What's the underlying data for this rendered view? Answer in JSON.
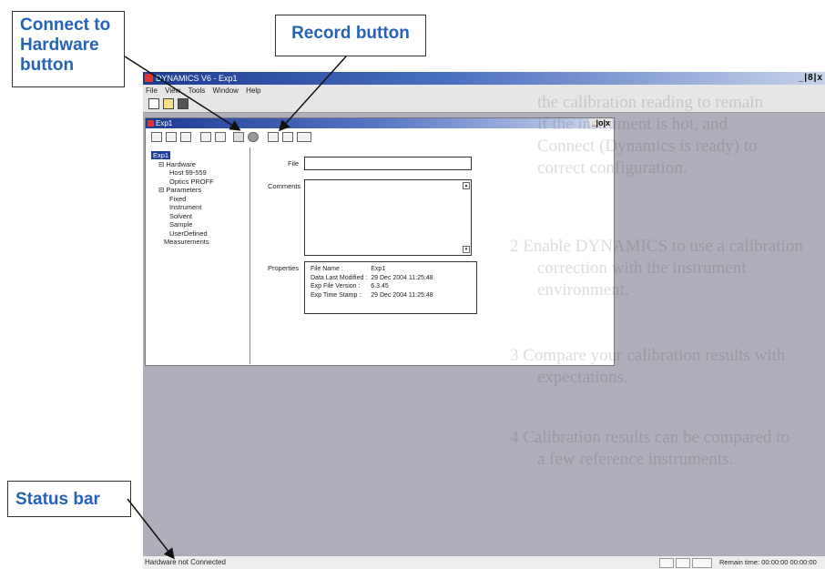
{
  "callouts": {
    "connect": "Connect to Hardware button",
    "record": "Record button",
    "status": "Status bar"
  },
  "app": {
    "title": "DYNAMICS V6 - Exp1",
    "window_controls": "_|8|x",
    "menu": [
      "File",
      "View",
      "Tools",
      "Window",
      "Help"
    ]
  },
  "child": {
    "title": "Exp1",
    "window_controls": "_|o|x",
    "tree": {
      "root": "Exp1",
      "hardware": "Hardware",
      "hw_items": [
        "Host 99-559",
        "Optics PROFF"
      ],
      "parameters": "Parameters",
      "param_items": [
        "Fixed",
        "Instrument",
        "Solvent",
        "Sample",
        "UserDefined"
      ],
      "measurements": "Measurements"
    },
    "labels": {
      "file": "File",
      "comments": "Comments",
      "properties": "Properties"
    },
    "file_value": "",
    "comments_value": "",
    "properties": {
      "file_name_label": "File Name :",
      "file_name": "Exp1",
      "modified_label": "Data Last Modified :",
      "modified": "29 Dec 2004 11:25:48",
      "version_label": "Exp File Version :",
      "version": "6.3.45",
      "stamp_label": "Exp Time Stamp :",
      "stamp": "29 Dec 2004 11:25:48"
    }
  },
  "overlay_lines": [
    "the calibration reading to remain",
    "if the instrument is hot, and",
    "Connect (Dynamics is ready) to",
    "correct configuration.",
    "2  Enable DYNAMICS to use a calibration",
    "correction with the instrument",
    "environment.",
    "3  Compare your calibration results with",
    "expectations.",
    "4  Calibration results can be compared to",
    "a few reference instruments."
  ],
  "status": {
    "message": "Hardware not Connected",
    "remain": "Remain time: 00:00:00  00:00:00"
  }
}
